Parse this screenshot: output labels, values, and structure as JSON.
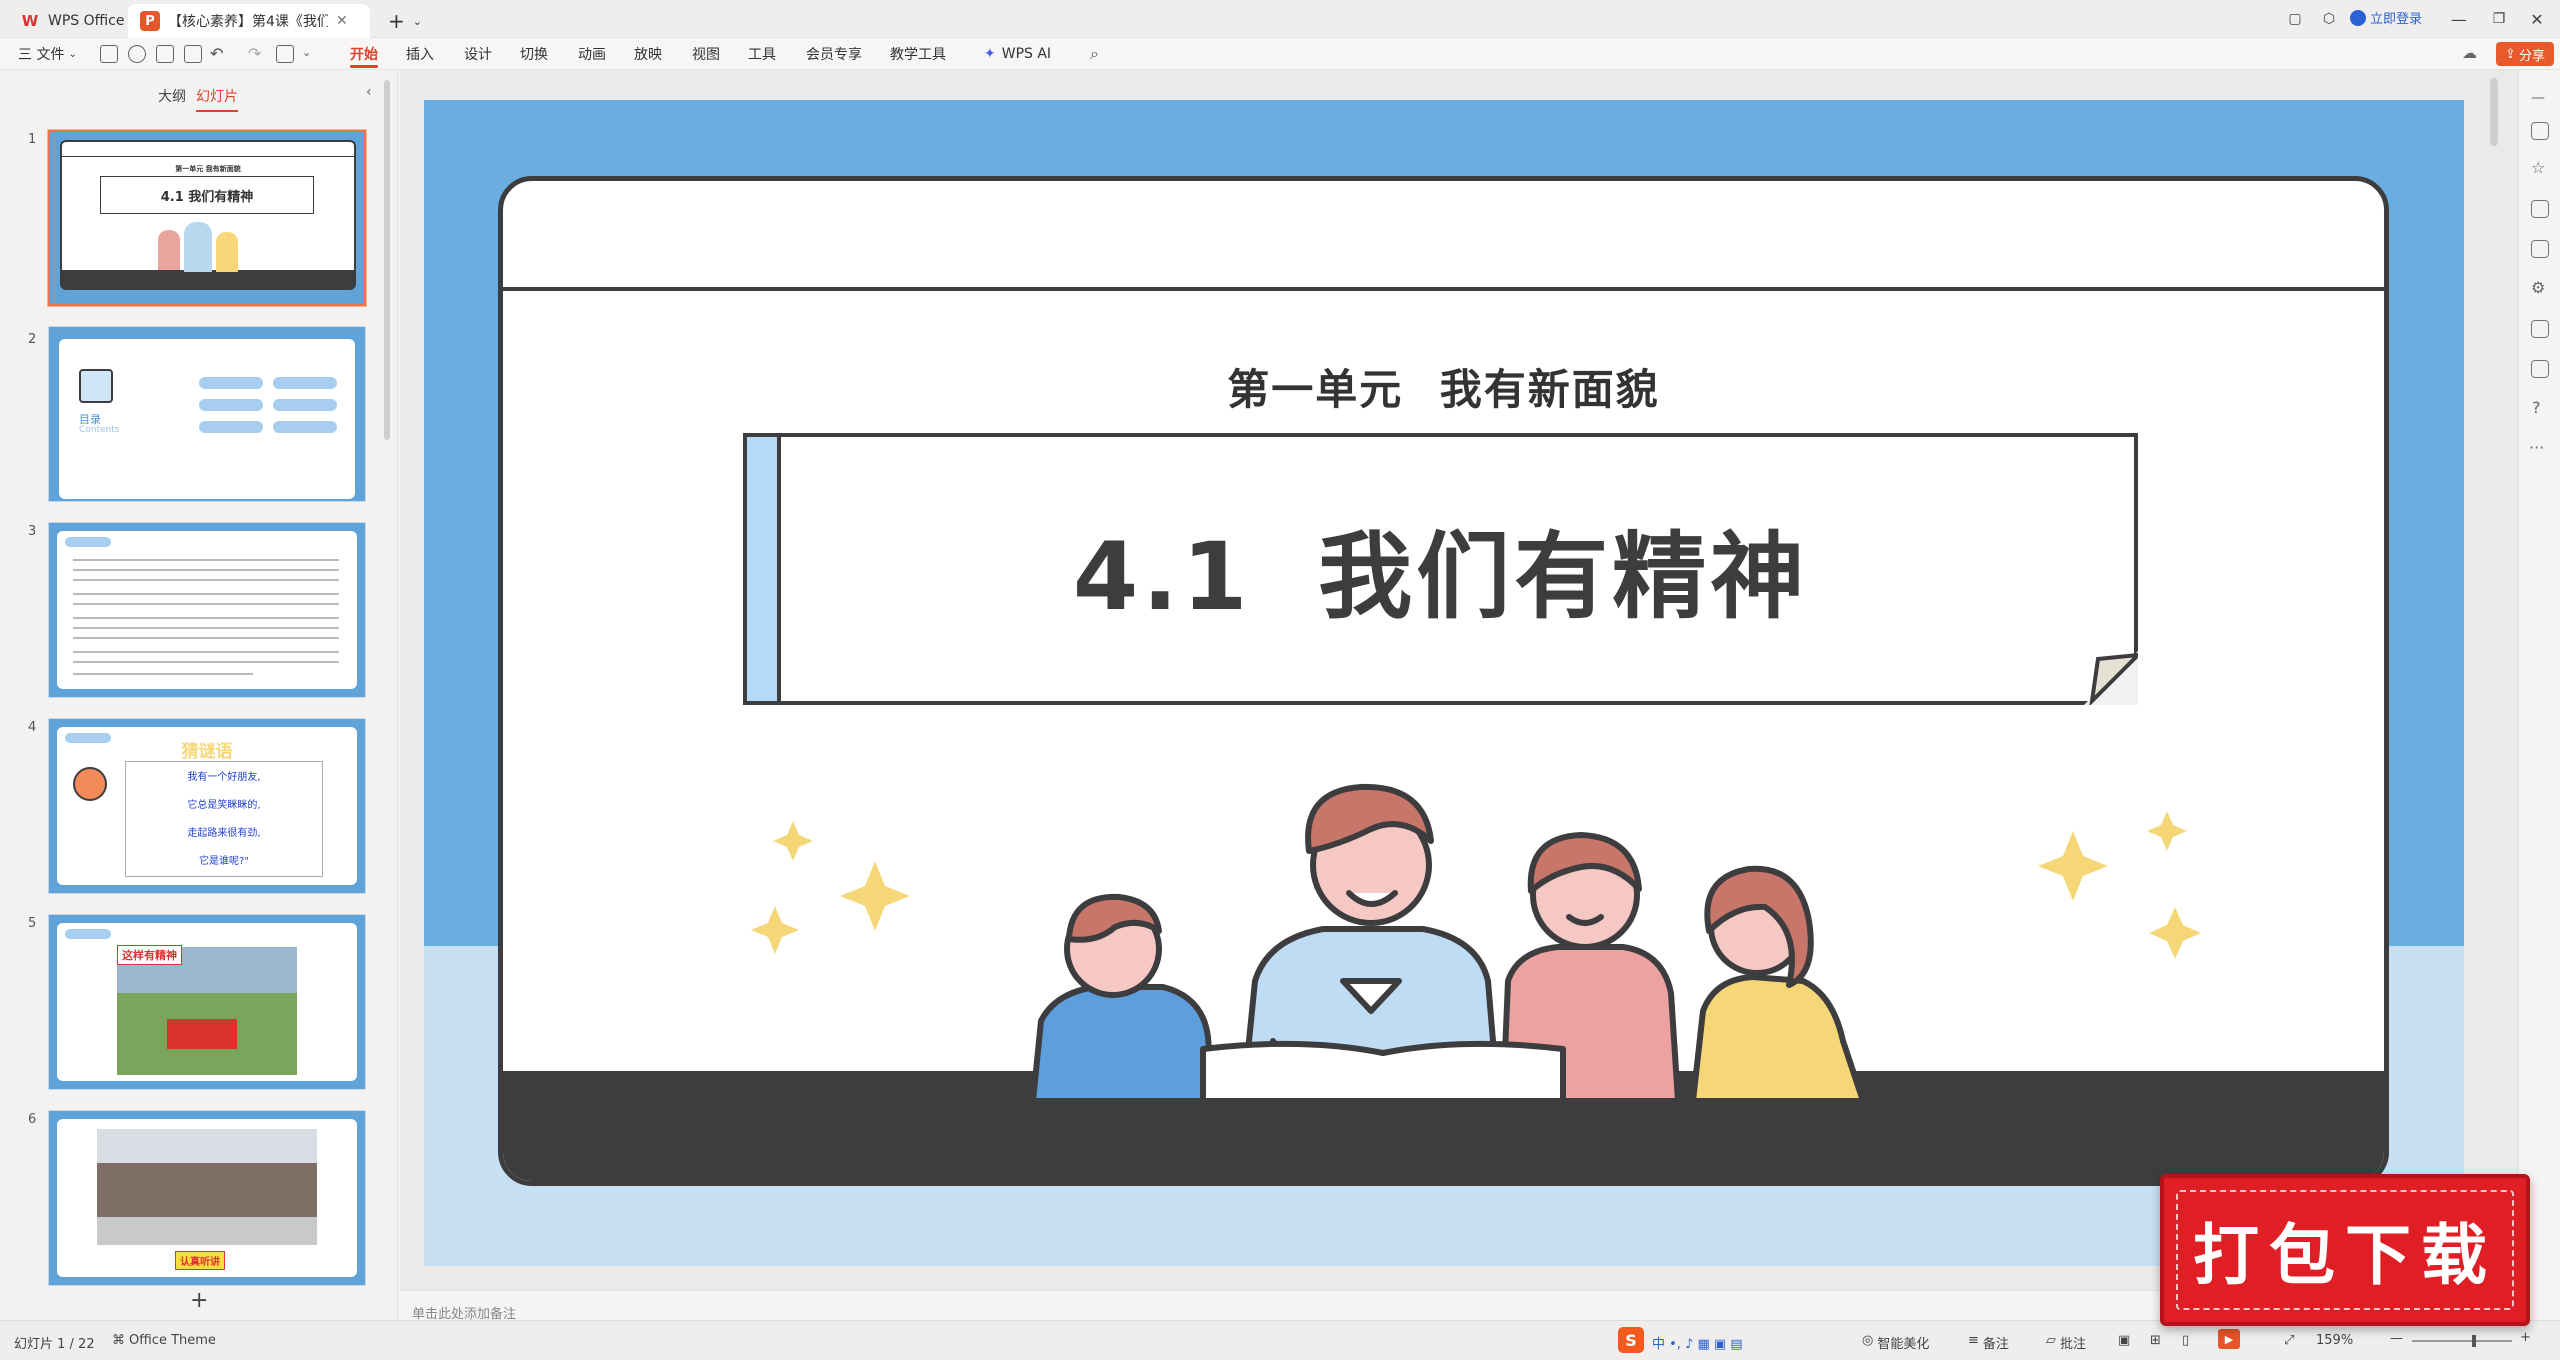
{
  "titlebar": {
    "home_tab": "WPS Office",
    "doc_tab": "【核心素养】第4课《我们有...",
    "login": "立即登录"
  },
  "menu": {
    "file": "三 文件",
    "items": [
      "开始",
      "插入",
      "设计",
      "切换",
      "动画",
      "放映",
      "视图",
      "工具",
      "会员专享",
      "教学工具"
    ],
    "ai": "WPS AI",
    "share": "分享"
  },
  "panel": {
    "tab_outline": "大纲",
    "tab_slides": "幻灯片",
    "slides": [
      "1",
      "2",
      "3",
      "4",
      "5",
      "6"
    ],
    "add": "+",
    "thumb2_title": "目录",
    "thumb2_sub": "Contents",
    "thumb4_title": "猜谜语",
    "thumb4_lines": [
      "我有一个好朋友,",
      "它总是笑眯眯的,",
      "走起路来很有劲,",
      "它是谁呢?\""
    ],
    "thumb5_label": "这样有精神",
    "thumb6_label": "认真听讲"
  },
  "slide": {
    "unit": "第一单元  我有新面貌",
    "title": "4.1  我们有精神",
    "thumb_unit": "第一单元 我有新面貌",
    "thumb_title": "4.1 我们有精神"
  },
  "notes": {
    "placeholder": "单击此处添加备注"
  },
  "status": {
    "slide_count": "幻灯片 1 / 22",
    "theme": "Office Theme",
    "beautify": "智能美化",
    "notes": "备注",
    "comment": "批注",
    "zoom": "159%"
  },
  "download_badge": "打包下载",
  "colors": {
    "accent": "#e0412c",
    "slide_blue": "#6aaee0",
    "dark": "#3d3d40"
  }
}
